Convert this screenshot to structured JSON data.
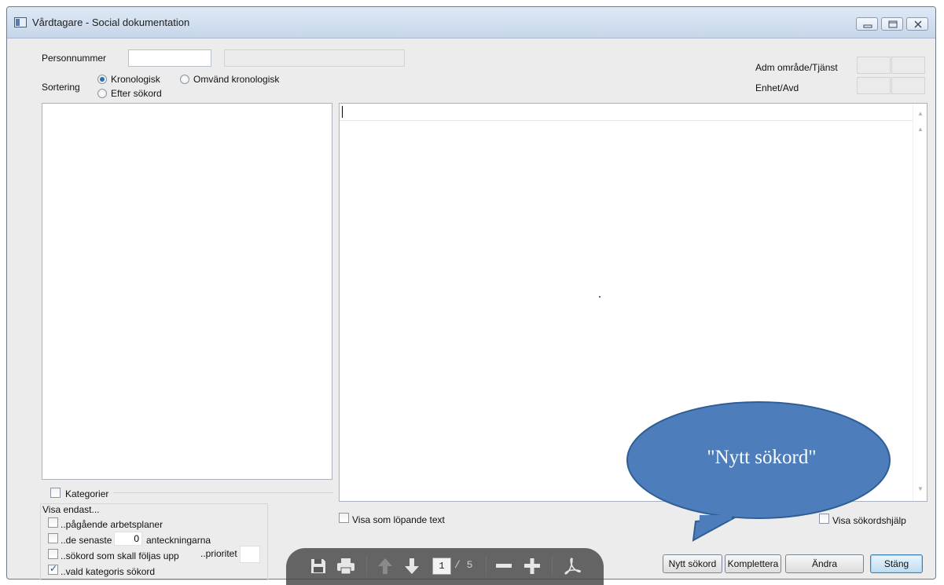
{
  "window": {
    "title": "Vårdtagare - Social dokumentation"
  },
  "header": {
    "personnummer_label": "Personnummer",
    "personnummer_value": "",
    "name_value": "",
    "sortering_label": "Sortering",
    "sort_options": [
      {
        "label": "Kronologisk",
        "checked": true
      },
      {
        "label": "Omvänd kronologisk",
        "checked": false
      },
      {
        "label": "Efter sökord",
        "checked": false
      }
    ],
    "adm_label": "Adm område/Tjänst",
    "enhet_label": "Enhet/Avd"
  },
  "left": {
    "kategorier_label": "Kategorier",
    "kategorier_checked": false,
    "visa_endast_label": "Visa endast...",
    "filters": [
      {
        "label": "..pågående arbetsplaner",
        "checked": false
      },
      {
        "label": "..de senaste",
        "checked": false,
        "count": "0",
        "suffix": "anteckningarna"
      },
      {
        "label": "..sökord som skall följas upp",
        "checked": false,
        "prioritet_label": "..prioritet"
      },
      {
        "label": "..vald kategoris sökord",
        "checked": true
      }
    ]
  },
  "right": {
    "visa_lopande_label": "Visa som löpande text",
    "visa_lopande_checked": false,
    "visa_sokordshjalp_label": "Visa sökordshjälp",
    "visa_sokordshjalp_checked": false
  },
  "buttons": {
    "nytt_sokord": "Nytt sökord",
    "komplettera": "Komplettera",
    "andra": "Ändra",
    "stang": "Stäng"
  },
  "pdf_toolbar": {
    "page": "1",
    "total": "/ 5"
  },
  "callout": {
    "text": "\"Nytt sökord\""
  },
  "colors": {
    "callout_fill": "#4d7dbb",
    "callout_stroke": "#2f5e96",
    "title_bar": "#c6d6ea"
  }
}
